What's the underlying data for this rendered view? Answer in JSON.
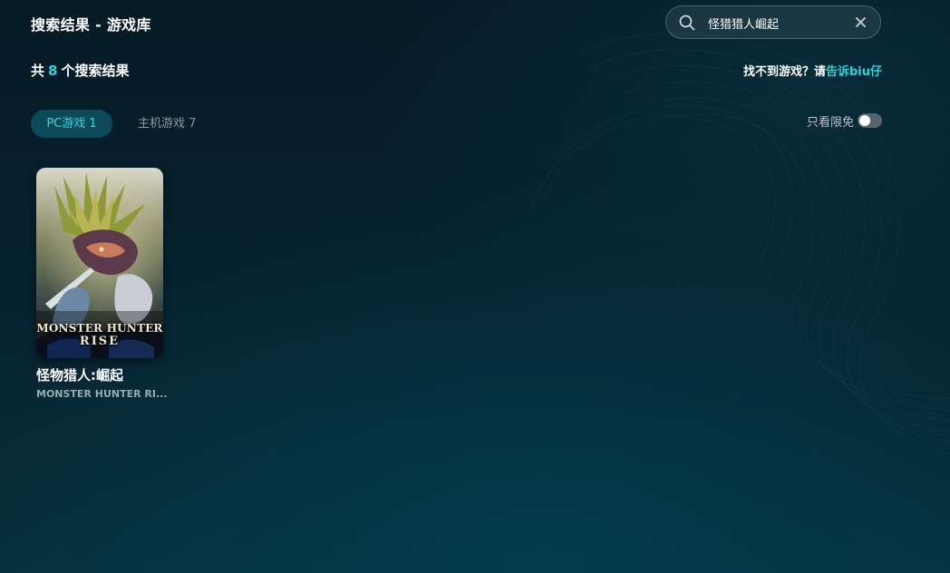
{
  "header": {
    "title": "搜索结果 - 游戏库"
  },
  "search": {
    "value": "怪猎猎人崛起",
    "placeholder": ""
  },
  "results": {
    "prefix": "共",
    "count": "8",
    "suffix": "个搜索结果"
  },
  "feedback": {
    "text": "找不到游戏？请",
    "link": "告诉biu仔"
  },
  "tabs": [
    {
      "label": "PC游戏 1",
      "active": true
    },
    {
      "label": "主机游戏 7",
      "active": false
    }
  ],
  "filter": {
    "free_only_label": "只看限免",
    "free_only_enabled": false
  },
  "games": [
    {
      "title": "怪物猎人:崛起",
      "subtitle": "MONSTER HUNTER RI...",
      "cover_logo_line1": "MONSTER HUNTER",
      "cover_logo_line2": "RISE"
    }
  ],
  "colors": {
    "accent": "#2fd0dd",
    "tab_active_bg": "#0c4a57",
    "background": "#062230"
  },
  "icons": {
    "search": "search-icon",
    "clear": "close-icon"
  }
}
